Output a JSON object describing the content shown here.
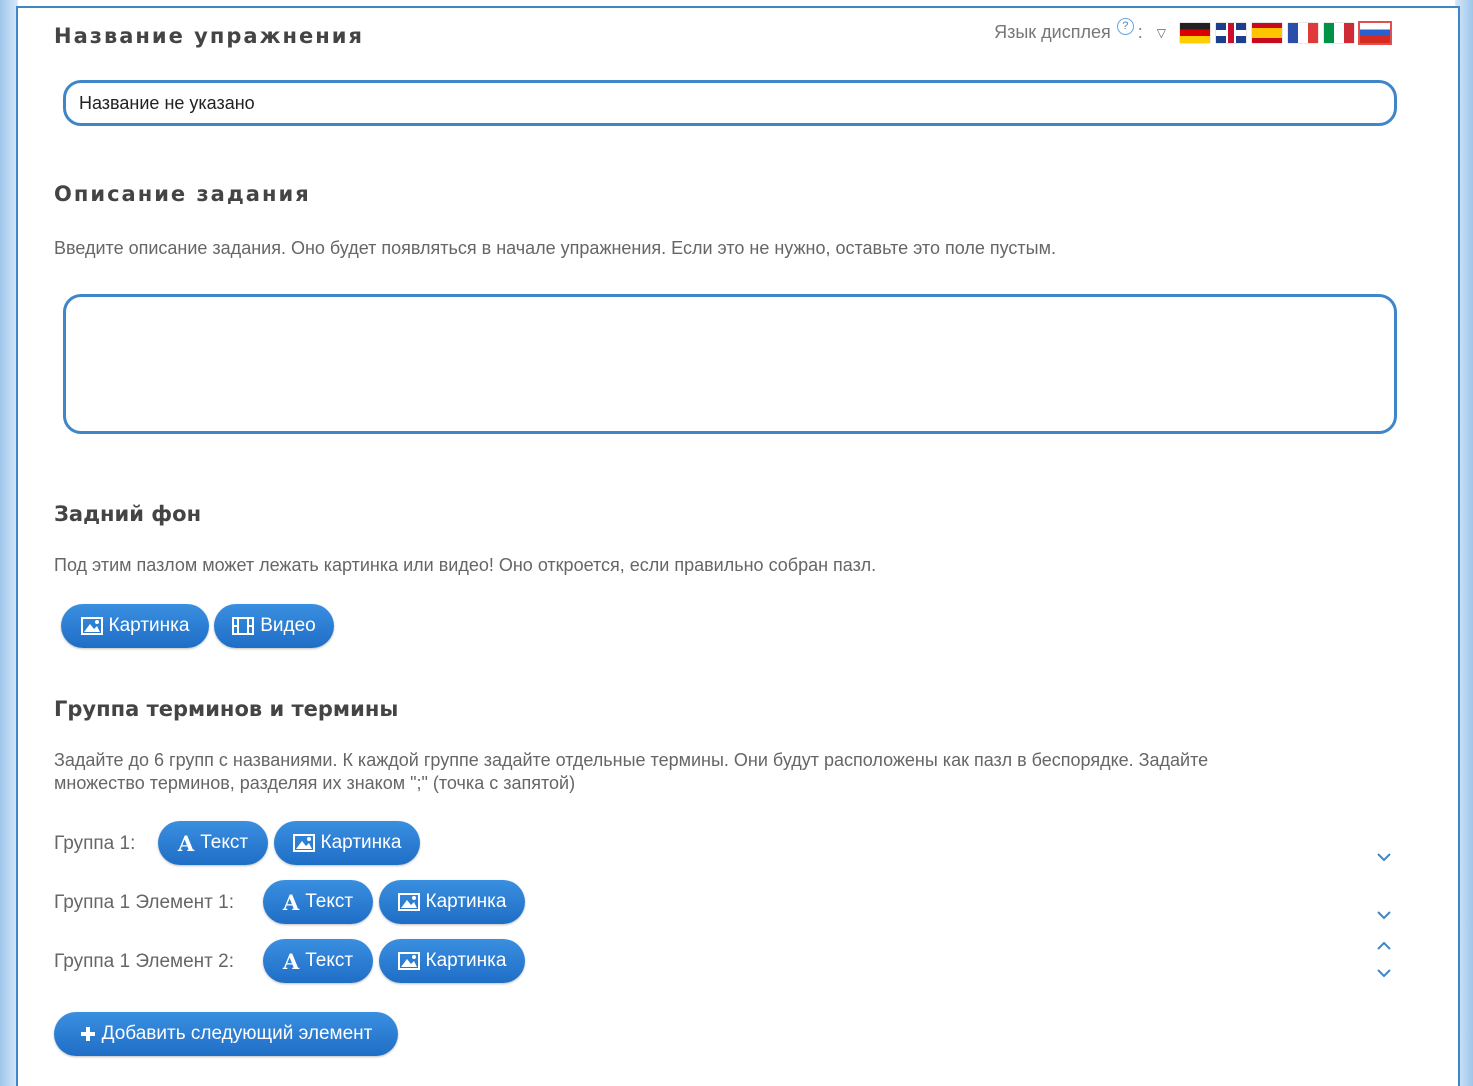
{
  "header": {
    "title": "Название упражнения",
    "display_language_label": "Язык дисплея",
    "help_symbol": "?",
    "colon": ":",
    "flags": [
      "de",
      "gb",
      "es",
      "fr",
      "it",
      "ru"
    ],
    "selected_flag": "ru"
  },
  "title_field": {
    "value": "Название не указано"
  },
  "task": {
    "heading": "Описание задания",
    "description": "Введите описание задания. Оно будет появляться в начале упражнения. Если это не нужно, оставьте это поле пустым.",
    "value": ""
  },
  "background": {
    "heading": "Задний фон",
    "description": "Под этим пазлом может лежать картинка или видео! Оно откроется, если правильно собран пазл.",
    "picture_label": "Картинка",
    "video_label": "Видео"
  },
  "terms": {
    "heading": "Группа терминов и термины",
    "description_line1": "Задайте до 6 групп с названиями. К каждой группе задайте отдельные термины. Они будут расположены как пазл в беспорядке. Задайте",
    "description_line2": "множество терминов, разделяя их знаком \";\" (точка с запятой)",
    "rows": [
      {
        "label": "Группа 1:",
        "text_label": "Текст",
        "picture_label": "Картинка"
      },
      {
        "label": "Группа 1 Элемент 1:",
        "text_label": "Текст",
        "picture_label": "Картинка"
      },
      {
        "label": "Группа 1 Элемент 2:",
        "text_label": "Текст",
        "picture_label": "Картинка"
      }
    ],
    "add_label": "Добавить следующий элемент"
  },
  "colors": {
    "accent": "#2a80d8",
    "border": "#3f86c8"
  }
}
